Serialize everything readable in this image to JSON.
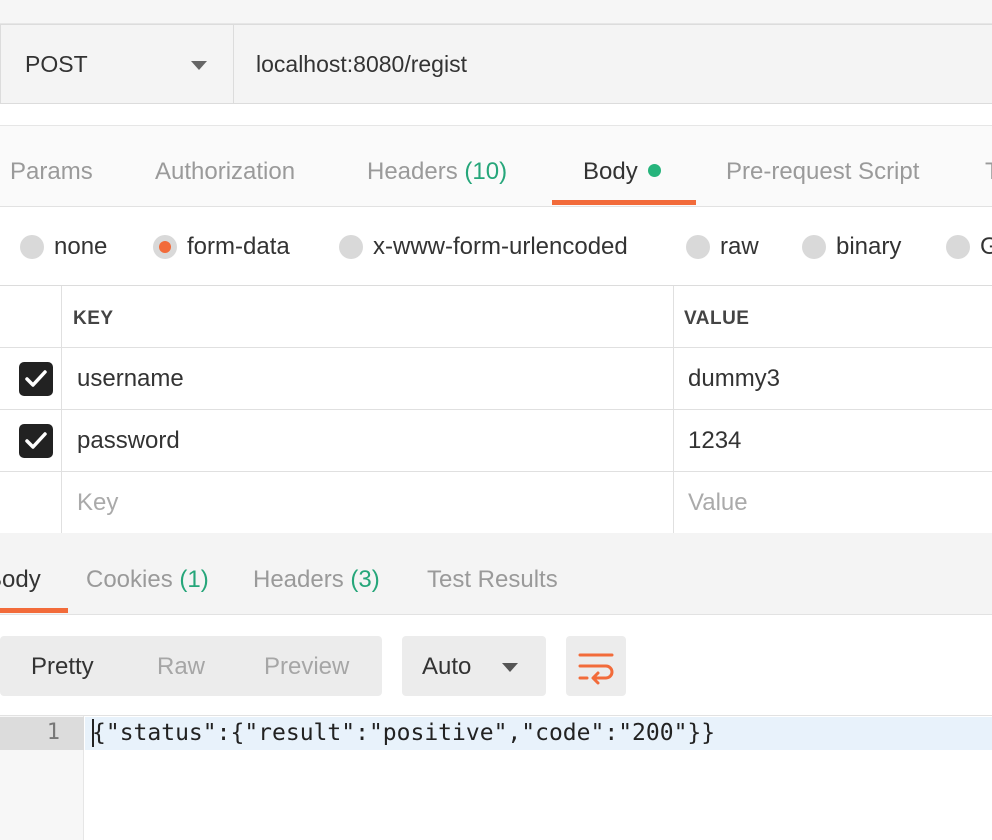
{
  "request": {
    "method": "POST",
    "url": "localhost:8080/regist"
  },
  "request_tabs": {
    "params": "Params",
    "authorization": "Authorization",
    "headers": "Headers",
    "headers_count": "(10)",
    "body": "Body",
    "prerequest": "Pre-request Script",
    "tests_partial": "T"
  },
  "body_types": {
    "none": "none",
    "form_data": "form-data",
    "urlencoded": "x-www-form-urlencoded",
    "raw": "raw",
    "binary": "binary",
    "graphql_partial": "G",
    "selected": "form-data"
  },
  "kv_table": {
    "key_header": "KEY",
    "value_header": "VALUE",
    "rows": [
      {
        "key": "username",
        "value": "dummy3",
        "checked": true
      },
      {
        "key": "password",
        "value": "1234",
        "checked": true
      }
    ],
    "key_placeholder": "Key",
    "value_placeholder": "Value"
  },
  "response_tabs": {
    "body": "Body",
    "cookies": "Cookies",
    "cookies_count": "(1)",
    "headers": "Headers",
    "headers_count": "(3)",
    "test_results": "Test Results"
  },
  "view_modes": {
    "pretty": "Pretty",
    "raw": "Raw",
    "preview": "Preview"
  },
  "format_select": "Auto",
  "response_code": {
    "line_number": "1",
    "text": "{\"status\":{\"result\":\"positive\",\"code\":\"200\"}}"
  },
  "colors": {
    "accent": "#f26b3a",
    "count": "#26a67a",
    "status_dot": "#26b47c"
  }
}
